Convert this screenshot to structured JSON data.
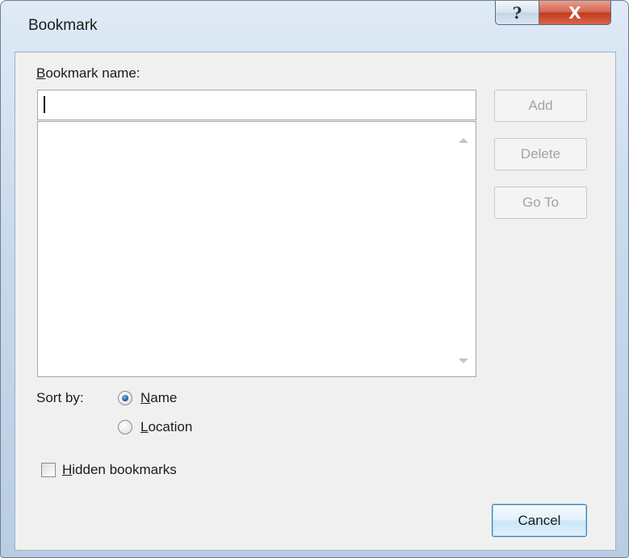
{
  "window": {
    "title": "Bookmark",
    "help_glyph": "?",
    "close_glyph": "X"
  },
  "form": {
    "name_label_first": "B",
    "name_label_rest": "ookmark name:",
    "name_value": "",
    "sort_label": "Sort by:",
    "sort_options": [
      {
        "first": "N",
        "rest": "ame",
        "checked": true
      },
      {
        "first": "L",
        "rest": "ocation",
        "checked": false
      }
    ],
    "hidden_first": "H",
    "hidden_rest": "idden bookmarks",
    "hidden_checked": false
  },
  "buttons": {
    "add": "Add",
    "delete": "Delete",
    "goto": "Go To",
    "cancel": "Cancel"
  },
  "icons": {
    "help": "help-icon",
    "close": "close-icon",
    "scroll_up": "scroll-up-icon",
    "scroll_down": "scroll-down-icon"
  }
}
